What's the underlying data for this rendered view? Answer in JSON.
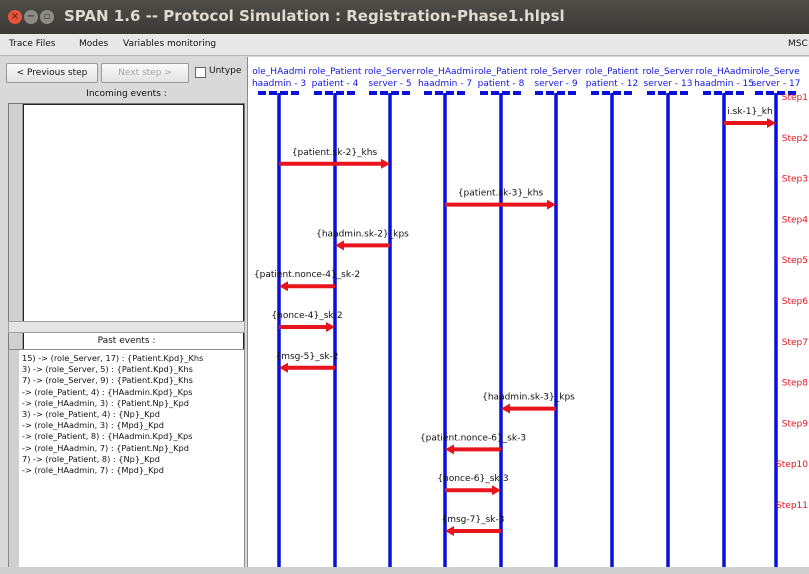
{
  "window": {
    "title": "SPAN 1.6 -- Protocol Simulation : Registration-Phase1.hlpsl",
    "close_glyph": "×",
    "min_glyph": "−",
    "max_glyph": "▫"
  },
  "menu": {
    "items": [
      "Trace Files",
      "Modes",
      "Variables monitoring"
    ],
    "msc_label": "MSC"
  },
  "toolbar": {
    "prev_label": "< Previous step",
    "next_label": "Next step >",
    "untype_label": "Untype"
  },
  "incoming": {
    "header": "Incoming events :"
  },
  "past": {
    "header": "Past events :",
    "events": [
      "15) -> (role_Server, 17) : {Patient.Kpd}_Khs",
      "3) -> (role_Server, 5) : {Patient.Kpd}_Khs",
      "7) -> (role_Server, 9) : {Patient.Kpd}_Khs",
      "-> (role_Patient, 4) : {HAadmin.Kpd}_Kps",
      " -> (role_HAadmin, 3) : {Patient.Np}_Kpd",
      "3) -> (role_Patient, 4) : {Np}_Kpd",
      " -> (role_HAadmin, 3) : {Mpd}_Kpd",
      "-> (role_Patient, 8) : {HAadmin.Kpd}_Kps",
      " -> (role_HAadmin, 7) : {Patient.Np}_Kpd",
      "7) -> (role_Patient, 8) : {Np}_Kpd",
      " -> (role_HAadmin, 7) : {Mpd}_Kpd"
    ]
  },
  "msc": {
    "roles": [
      {
        "name": "ole_HAadmi",
        "instance": "haadmin - 3"
      },
      {
        "name": "role_Patient",
        "instance": "patient - 4"
      },
      {
        "name": "role_Server",
        "instance": "server - 5"
      },
      {
        "name": "role_HAadmi",
        "instance": "haadmin - 7"
      },
      {
        "name": "role_Patient",
        "instance": "patient - 8"
      },
      {
        "name": "role_Server",
        "instance": "server - 9"
      },
      {
        "name": "role_Patient",
        "instance": "patient - 12"
      },
      {
        "name": "role_Server",
        "instance": "server - 13"
      },
      {
        "name": "role_HAadmi",
        "instance": "haadmin - 15"
      },
      {
        "name": "role_Serve",
        "instance": "server - 17"
      }
    ],
    "steps": [
      "Step1",
      "Step2",
      "Step3",
      "Step4",
      "Step5",
      "Step6",
      "Step7",
      "Step8",
      "Step9",
      "Step10",
      "Step11"
    ],
    "messages": [
      {
        "label": "i.sk-1}_kh",
        "from": 8,
        "to": 9,
        "step": 1
      },
      {
        "label": "{patient.sk-2}_khs",
        "from": 0,
        "to": 2,
        "step": 2
      },
      {
        "label": "{patient.sk-3}_khs",
        "from": 3,
        "to": 5,
        "step": 3
      },
      {
        "label": "{haadmin.sk-2}_kps",
        "from": 2,
        "to": 1,
        "step": 4
      },
      {
        "label": "{patient.nonce-4}_sk-2",
        "from": 1,
        "to": 0,
        "step": 5
      },
      {
        "label": "{nonce-4}_sk-2",
        "from": 0,
        "to": 1,
        "step": 6
      },
      {
        "label": "{msg-5}_sk-2",
        "from": 1,
        "to": 0,
        "step": 7
      },
      {
        "label": "{haadmin.sk-3}_kps",
        "from": 5,
        "to": 4,
        "step": 8
      },
      {
        "label": "{patient.nonce-6}_sk-3",
        "from": 4,
        "to": 3,
        "step": 9
      },
      {
        "label": "{nonce-6}_sk-3",
        "from": 3,
        "to": 4,
        "step": 10
      },
      {
        "label": "{msg-7}_sk-3",
        "from": 4,
        "to": 3,
        "step": 11
      }
    ],
    "colors": {
      "lifeline": "#0a10d8",
      "arrow": "#e8141c",
      "role_text": "#1414e0",
      "step_text": "#e8141c"
    }
  }
}
